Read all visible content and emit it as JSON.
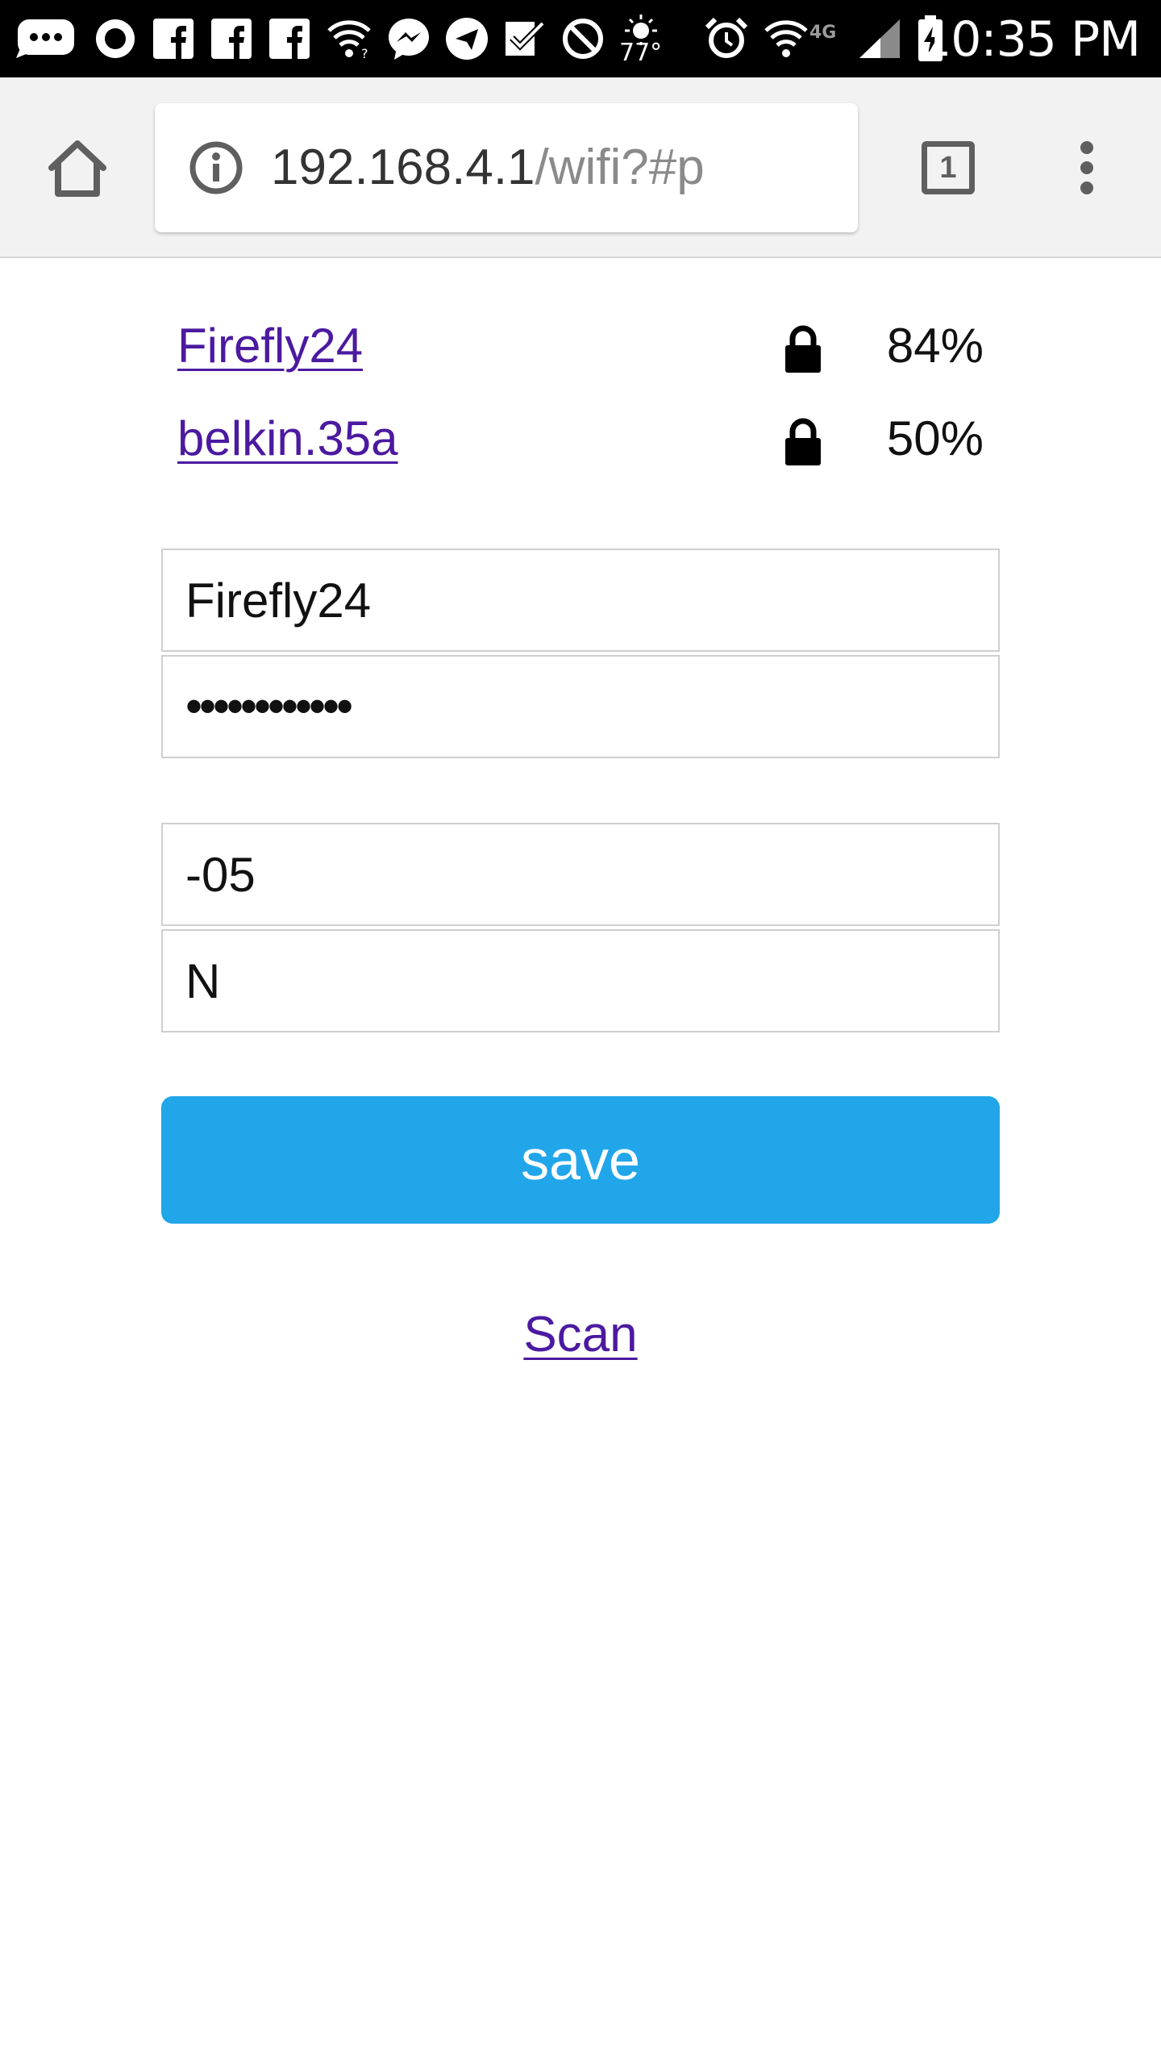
{
  "status_bar": {
    "time": "10:35 PM",
    "temperature": "77°",
    "network_type": "4G",
    "icons": [
      "chat-bubble-icon",
      "circle-icon",
      "facebook-icon",
      "facebook-icon",
      "facebook-icon",
      "wifi-question-icon",
      "messenger-icon",
      "send-icon",
      "checkmark-icon",
      "block-icon",
      "weather-icon",
      "alarm-icon",
      "wifi-icon",
      "signal-icon",
      "battery-charging-icon"
    ]
  },
  "browser": {
    "url_host": "192.168.4.1",
    "url_path": "/wifi?#p",
    "tab_count": "1"
  },
  "networks": [
    {
      "ssid": "Firefly24",
      "signal": "84%",
      "secured": true
    },
    {
      "ssid": "belkin.35a",
      "signal": "50%",
      "secured": true
    }
  ],
  "form": {
    "ssid_value": "Firefly24",
    "password_masked": "••••••••••••",
    "field3_value": "-05",
    "field4_value": "N",
    "save_label": "save",
    "scan_label": "Scan"
  },
  "colors": {
    "status_bar_bg": "#000000",
    "toolbar_bg": "#f2f2f2",
    "link": "#4b1aa0",
    "save_button": "#22a6ea"
  }
}
